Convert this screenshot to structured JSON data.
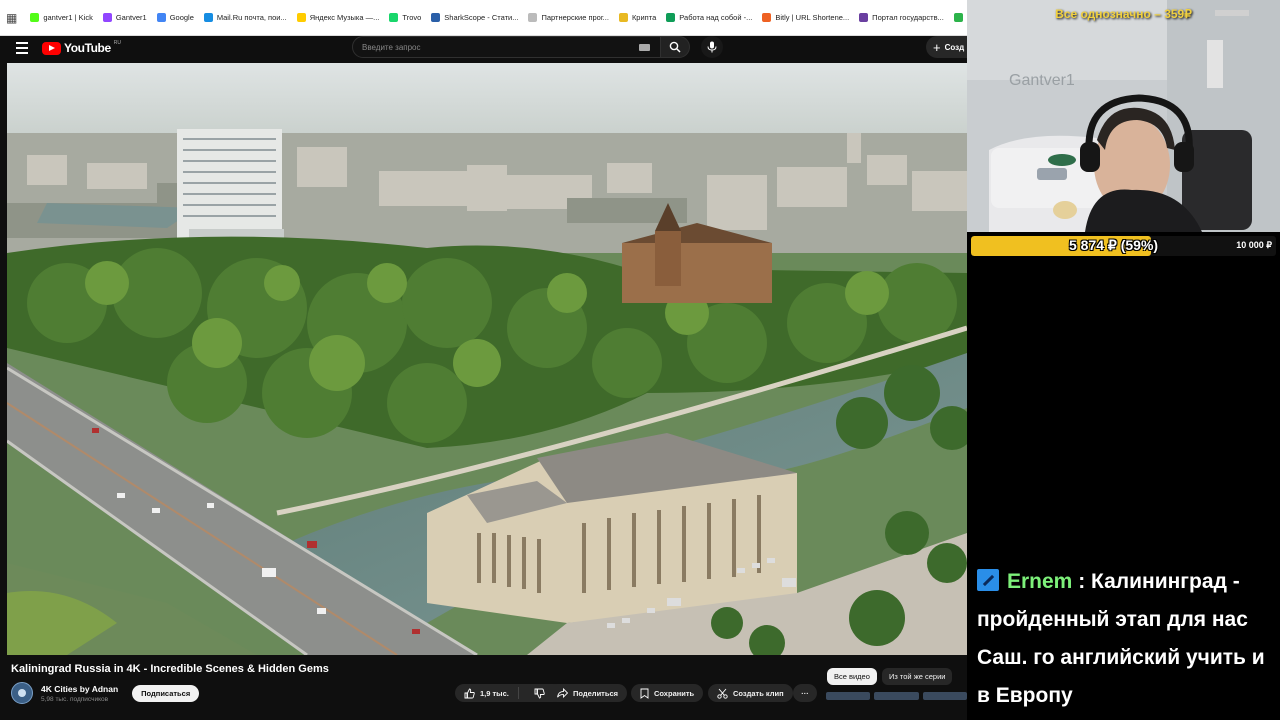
{
  "bookmarks": [
    {
      "label": "gantver1 | Kick",
      "color": "#53fc18"
    },
    {
      "label": "Gantver1",
      "color": "#9146ff"
    },
    {
      "label": "Google",
      "color": "#4285f4"
    },
    {
      "label": "Mail.Ru почта, пои...",
      "color": "#168de2"
    },
    {
      "label": "Яндекс Музыка —...",
      "color": "#ffcc00"
    },
    {
      "label": "Trovo",
      "color": "#19d66b"
    },
    {
      "label": "SharkScope - Стати...",
      "color": "#2a5fa8"
    },
    {
      "label": "Партнерские прог...",
      "color": "#bbbbbb"
    },
    {
      "label": "Крипта",
      "color": "#e8b923"
    },
    {
      "label": "Работа над собой -...",
      "color": "#0f9d58"
    },
    {
      "label": "Bitly | URL Shortene...",
      "color": "#ee6123"
    },
    {
      "label": "Портал государств...",
      "color": "#6a3fa0"
    },
    {
      "label": "The Best Free Live S...",
      "color": "#2cb34a"
    }
  ],
  "youtube": {
    "logo_text": "YouTube",
    "country_code": "RU",
    "search_placeholder": "Введите запрос",
    "create_label": "Созд"
  },
  "video": {
    "title": "Kaliningrad Russia in 4K - Incredible Scenes & Hidden Gems",
    "channel": "4K Cities by Adnan",
    "subscribers": "5,98 тыс. подписчиков",
    "subscribe_label": "Подписаться",
    "likes": "1,9 тыс.",
    "share_label": "Поделиться",
    "save_label": "Сохранить",
    "clip_label": "Создать клип",
    "more_label": "···"
  },
  "recommendations": {
    "chips": [
      "Все видео",
      "Из той же серии"
    ]
  },
  "stream": {
    "top_goal_text": "Все однозначно – 359₽",
    "goal_current": "5 874 ₽ (59%)",
    "goal_target": "10 000 ₽",
    "goal_fraction": 0.59,
    "accent_color": "#f0c020",
    "webcam_wall_text": "Gantver1",
    "chat": {
      "user": "Ernem",
      "separator": " : ",
      "message": "Калининград - пройденный этап для нас Саш. го английский учить и в Европу",
      "user_color": "#7df07a"
    }
  }
}
